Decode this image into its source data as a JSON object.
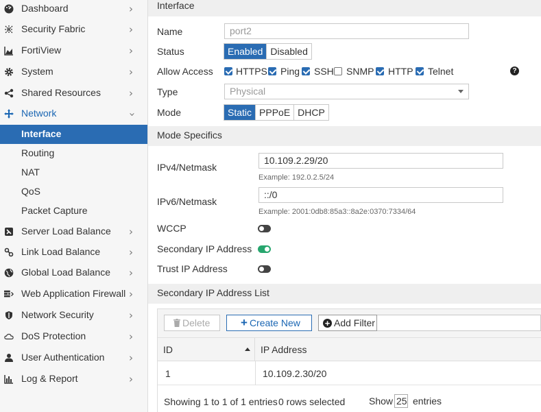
{
  "sidebar": {
    "items": [
      {
        "label": "Dashboard",
        "icon": "dashboard-icon"
      },
      {
        "label": "Security Fabric",
        "icon": "fabric-icon"
      },
      {
        "label": "FortiView",
        "icon": "chart-icon"
      },
      {
        "label": "System",
        "icon": "gear-icon"
      },
      {
        "label": "Shared Resources",
        "icon": "share-icon"
      },
      {
        "label": "Network",
        "icon": "network-icon"
      },
      {
        "label": "Server Load Balance",
        "icon": "server-icon"
      },
      {
        "label": "Link Load Balance",
        "icon": "link-icon"
      },
      {
        "label": "Global Load Balance",
        "icon": "globe-icon"
      },
      {
        "label": "Web Application Firewall",
        "icon": "firewall-icon"
      },
      {
        "label": "Network Security",
        "icon": "shield-icon"
      },
      {
        "label": "DoS Protection",
        "icon": "cloud-icon"
      },
      {
        "label": "User Authentication",
        "icon": "user-icon"
      },
      {
        "label": "Log & Report",
        "icon": "report-icon"
      }
    ],
    "network_sub": [
      "Interface",
      "Routing",
      "NAT",
      "QoS",
      "Packet Capture"
    ]
  },
  "form": {
    "section_title": "Interface",
    "name_label": "Name",
    "name_value": "port2",
    "status_label": "Status",
    "status_options": [
      "Enabled",
      "Disabled"
    ],
    "status_selected": "Enabled",
    "allow_access_label": "Allow Access",
    "access": [
      {
        "label": "HTTPS",
        "checked": true
      },
      {
        "label": "Ping",
        "checked": true
      },
      {
        "label": "SSH",
        "checked": true
      },
      {
        "label": "SNMP",
        "checked": false
      },
      {
        "label": "HTTP",
        "checked": true
      },
      {
        "label": "Telnet",
        "checked": true
      }
    ],
    "help": "?",
    "type_label": "Type",
    "type_value": "Physical",
    "mode_label": "Mode",
    "mode_options": [
      "Static",
      "PPPoE",
      "DHCP"
    ],
    "mode_selected": "Static"
  },
  "mode_specifics": {
    "section_title": "Mode Specifics",
    "ipv4_label": "IPv4/Netmask",
    "ipv4_value": "10.109.2.29/20",
    "ipv4_example": "Example: 192.0.2.5/24",
    "ipv6_label": "IPv6/Netmask",
    "ipv6_value": "::/0",
    "ipv6_example": "Example: 2001:0db8:85a3::8a2e:0370:7334/64",
    "wccp_label": "WCCP",
    "wccp_on": false,
    "secondary_label": "Secondary IP Address",
    "secondary_on": true,
    "trust_label": "Trust IP Address",
    "trust_on": false
  },
  "secondary_list": {
    "section_title": "Secondary IP Address List",
    "delete_label": "Delete",
    "create_label": "Create New",
    "filter_label": "Add Filter",
    "columns": [
      "ID",
      "IP Address"
    ],
    "rows": [
      {
        "id": "1",
        "ip": "10.109.2.30/20"
      }
    ],
    "showing": "Showing 1 to 1 of 1 entries",
    "selected": "0 rows selected",
    "show_label": "Show",
    "page_size": "25",
    "entries_label": "entries"
  },
  "colors": {
    "accent": "#2a6cb3",
    "toggle_on": "#27a66e"
  }
}
